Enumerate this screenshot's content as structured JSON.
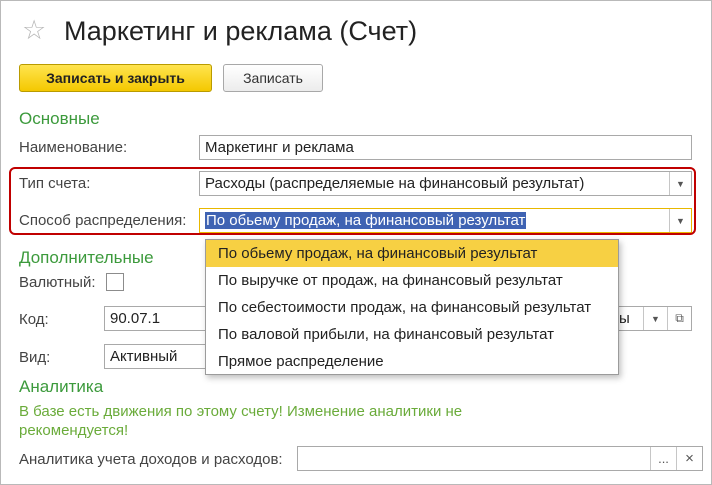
{
  "window": {
    "title": "Маркетинг и реклама (Счет)"
  },
  "toolbar": {
    "save_close_label": "Записать и закрыть",
    "save_label": "Записать"
  },
  "main_section": {
    "heading": "Основные",
    "name_label": "Наименование:",
    "name_value": "Маркетинг и реклама",
    "account_type_label": "Тип счета:",
    "account_type_value": "Расходы (распределяемые на финансовый результат)",
    "distribution_label": "Способ распределения:",
    "distribution_value": "По обьему продаж, на финансовый результат"
  },
  "extra_section": {
    "heading": "Дополнительные",
    "currency_label": "Валютный:",
    "currency_checked": false,
    "code_label": "Код:",
    "code_value": "90.07.1",
    "code_suffix": "ы",
    "kind_label": "Вид:",
    "kind_value": "Активный"
  },
  "analytics_section": {
    "heading": "Аналитика",
    "warning_line1": "В базе есть движения по этому счету! Изменение аналитики не",
    "warning_line2": "рекомендуется!",
    "analytics_label": "Аналитика учета доходов и расходов:",
    "analytics_value": "",
    "choose_button": "...",
    "clear_button": "×"
  },
  "distribution_dropdown": {
    "options": [
      "По обьему продаж, на финансовый результат",
      "По выручке от продаж, на финансовый результат",
      "По себестоимости продаж, на финансовый результат",
      "По валовой прибыли, на финансовый результат",
      "Прямое распределение"
    ],
    "selected_index": 0
  },
  "colors": {
    "accent_yellow": "#f4c800",
    "section_green": "#3c9a3c",
    "warning_green": "#6aab3a",
    "highlight_red": "#c00000",
    "selection_blue": "#3f63b3"
  },
  "icons": {
    "favorite": "star-icon",
    "dropdown": "chevron-down-icon",
    "open": "open-form-icon"
  }
}
